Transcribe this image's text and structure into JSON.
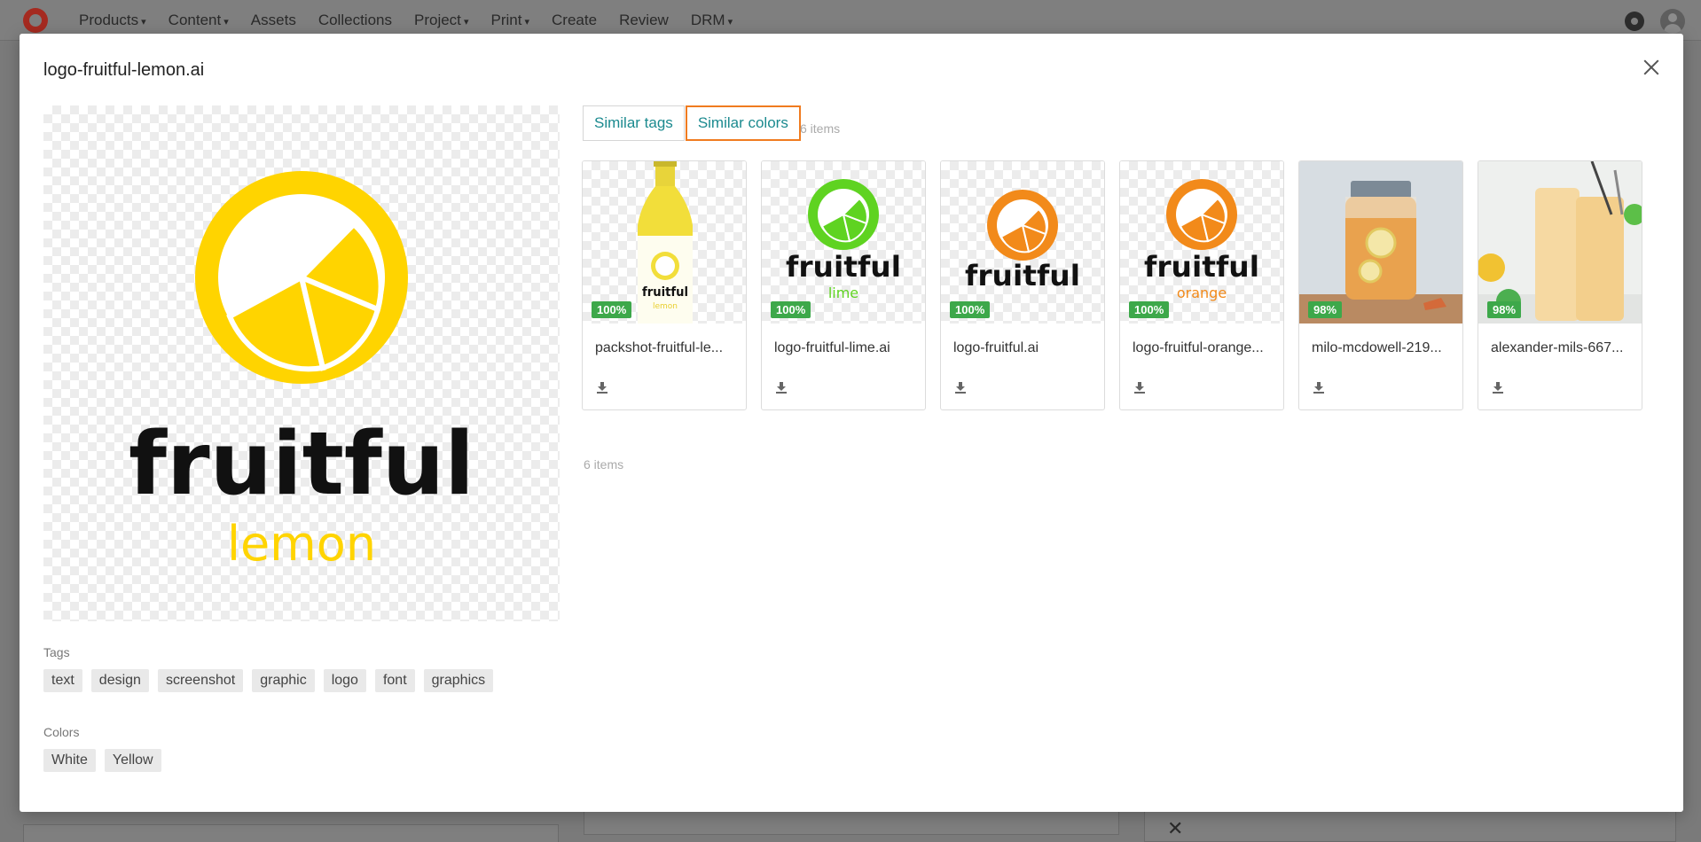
{
  "nav": {
    "items": [
      {
        "label": "Products",
        "dropdown": true
      },
      {
        "label": "Content",
        "dropdown": true
      },
      {
        "label": "Assets",
        "dropdown": false
      },
      {
        "label": "Collections",
        "dropdown": false
      },
      {
        "label": "Project",
        "dropdown": true
      },
      {
        "label": "Print",
        "dropdown": true
      },
      {
        "label": "Create",
        "dropdown": false
      },
      {
        "label": "Review",
        "dropdown": false
      },
      {
        "label": "DRM",
        "dropdown": true
      }
    ],
    "icons": [
      "brand-logo-icon",
      "gear-icon",
      "user-avatar-icon"
    ]
  },
  "modal": {
    "title": "logo-fruitful-lemon.ai",
    "preview": {
      "brand_word": "fruitful",
      "variant_word": "lemon",
      "accent_color": "#FFD400",
      "text_color": "#111111"
    },
    "tags_label": "Tags",
    "tags": [
      "text",
      "design",
      "screenshot",
      "graphic",
      "logo",
      "font",
      "graphics"
    ],
    "colors_label": "Colors",
    "colors": [
      "White",
      "Yellow"
    ],
    "tabs": [
      {
        "label": "Similar tags",
        "active": false
      },
      {
        "label": "Similar colors",
        "active": true
      }
    ],
    "item_count": "6 items",
    "items": [
      {
        "name": "packshot-fruitful-le...",
        "match": "100%",
        "kind": "bottle",
        "color": "#F2DE3A"
      },
      {
        "name": "logo-fruitful-lime.ai",
        "match": "100%",
        "kind": "logo",
        "color": "#5FD321",
        "sub": "lime"
      },
      {
        "name": "logo-fruitful.ai",
        "match": "100%",
        "kind": "logo",
        "color": "#F28A1A",
        "sub": ""
      },
      {
        "name": "logo-fruitful-orange...",
        "match": "100%",
        "kind": "logo",
        "color": "#F28A1A",
        "sub": "orange"
      },
      {
        "name": "milo-mcdowell-219...",
        "match": "98%",
        "kind": "jar",
        "color": "#E9A24E"
      },
      {
        "name": "alexander-mils-667...",
        "match": "98%",
        "kind": "glasses",
        "color": "#F6D9A2"
      }
    ],
    "accent_tab_border": "#F07B1F",
    "badge_color": "#3DA84A"
  }
}
